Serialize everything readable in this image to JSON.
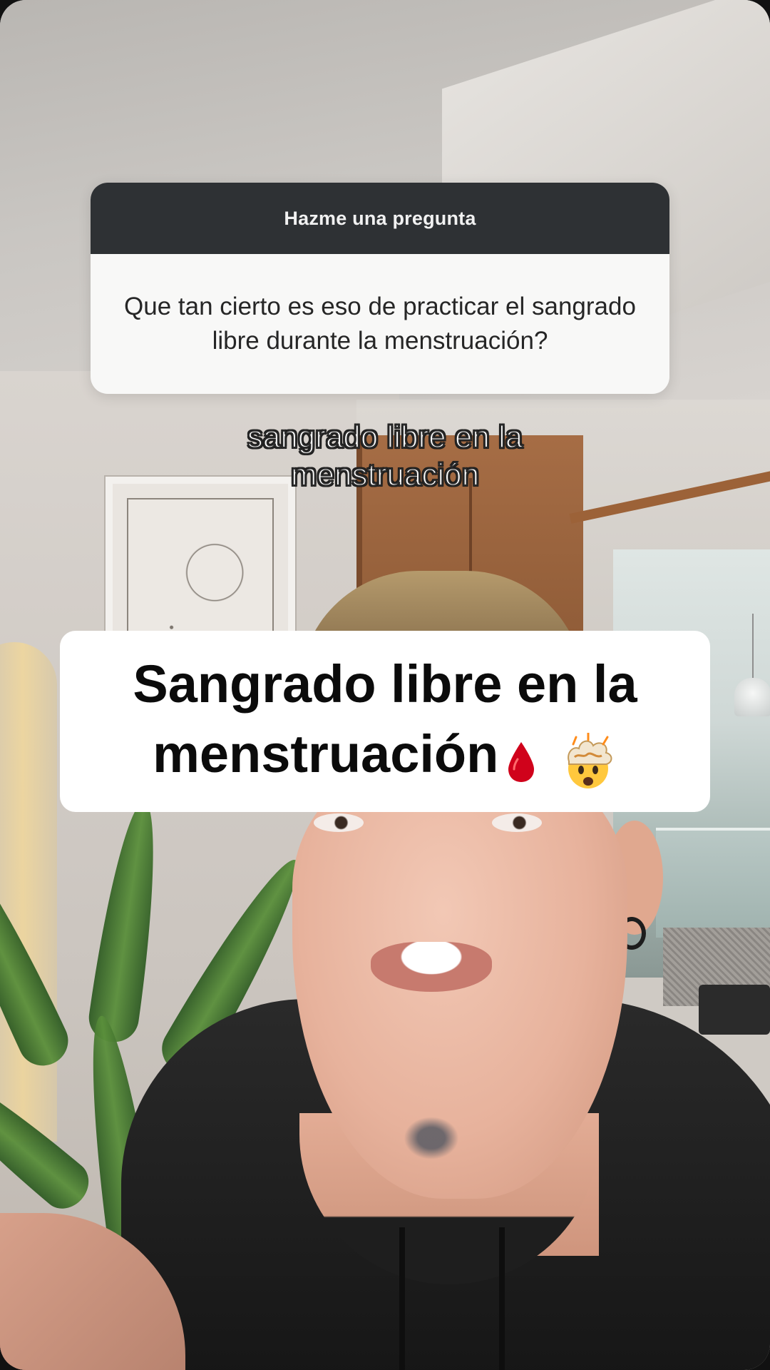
{
  "question_box": {
    "header": "Hazme una pregunta",
    "question": "Que tan cierto es eso de practicar el sangrado libre durante la menstruación?"
  },
  "caption": {
    "line1": "sangrado libre en la",
    "line2": "menstruación"
  },
  "title": {
    "line1": "Sangrado libre en la",
    "line2": "menstruación"
  },
  "emojis": [
    "drop-of-blood-icon",
    "exploding-head-icon"
  ],
  "colors": {
    "question_header_bg": "#2e3134",
    "question_body_bg": "#f8f8f7",
    "title_bg": "#ffffff",
    "blood_red": "#d0021b"
  }
}
